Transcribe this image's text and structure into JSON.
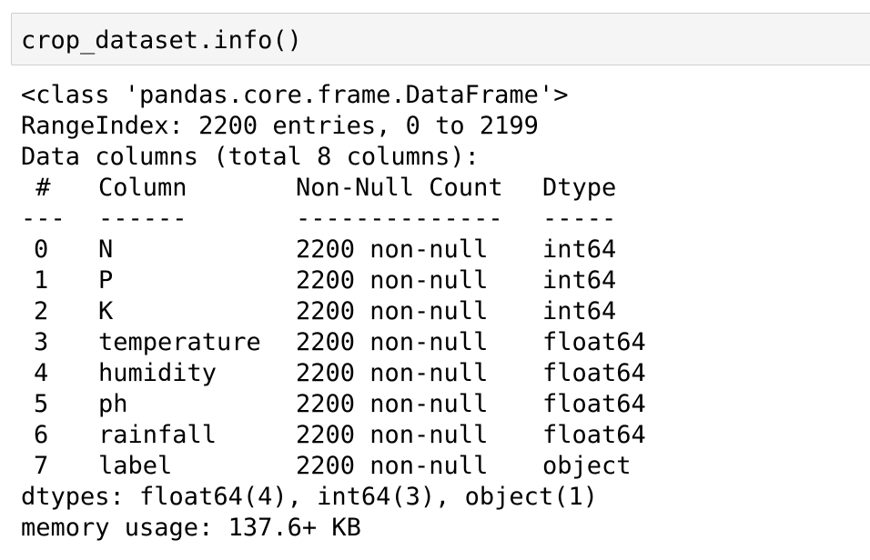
{
  "input_cell": {
    "code": "crop_dataset.info()"
  },
  "output": {
    "class_line": "<class 'pandas.core.frame.DataFrame'>",
    "range_index": "RangeIndex: 2200 entries, 0 to 2199",
    "columns_summary": "Data columns (total 8 columns):",
    "header": {
      "index": " #",
      "column": "Column",
      "non_null_count": "Non-Null Count",
      "dtype": "Dtype"
    },
    "separator": {
      "index": "---",
      "column": "------",
      "non_null_count": "--------------",
      "dtype": "-----"
    },
    "rows": [
      {
        "index": "0",
        "column": "N",
        "count": "2200 non-null",
        "dtype": "int64"
      },
      {
        "index": "1",
        "column": "P",
        "count": "2200 non-null",
        "dtype": "int64"
      },
      {
        "index": "2",
        "column": "K",
        "count": "2200 non-null",
        "dtype": "int64"
      },
      {
        "index": "3",
        "column": "temperature",
        "count": "2200 non-null",
        "dtype": "float64"
      },
      {
        "index": "4",
        "column": "humidity",
        "count": "2200 non-null",
        "dtype": "float64"
      },
      {
        "index": "5",
        "column": "ph",
        "count": "2200 non-null",
        "dtype": "float64"
      },
      {
        "index": "6",
        "column": "rainfall",
        "count": "2200 non-null",
        "dtype": "float64"
      },
      {
        "index": "7",
        "column": "label",
        "count": "2200 non-null",
        "dtype": "object"
      }
    ],
    "dtypes_line": "dtypes: float64(4), int64(3), object(1)",
    "memory_line": "memory usage: 137.6+ KB"
  }
}
